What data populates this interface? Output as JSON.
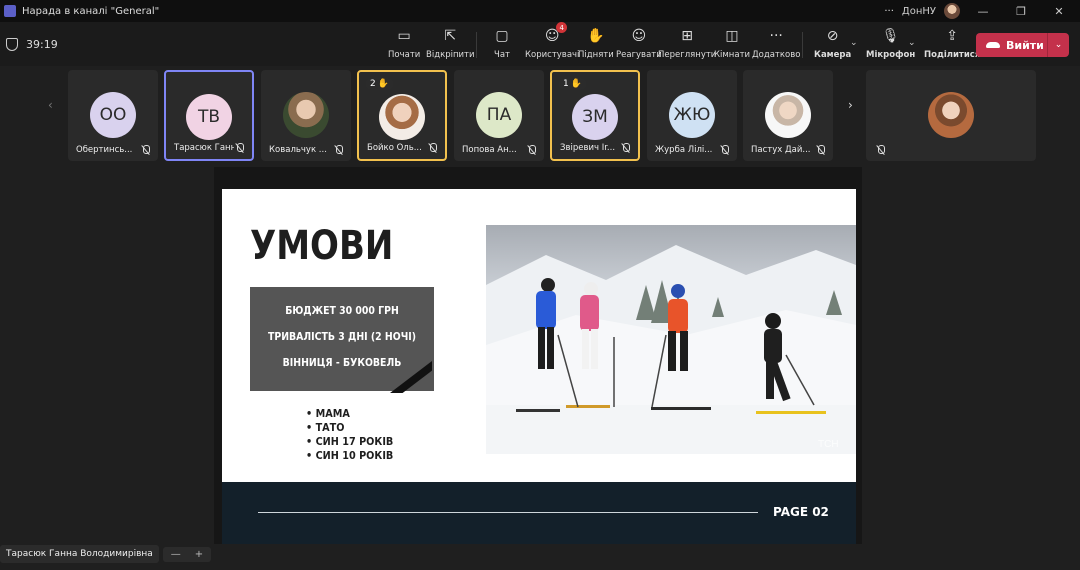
{
  "window": {
    "title": "Нарада в каналі \"General\"",
    "org": "ДонНУ",
    "more": "···",
    "controls": [
      "—",
      "❐",
      "✕"
    ]
  },
  "toolbar": {
    "timer": "39:19",
    "buttons": [
      {
        "label": "Почати",
        "icon": "present-icon"
      },
      {
        "label": "Відкріпити",
        "icon": "unpin-icon"
      },
      {
        "label": "Чат",
        "icon": "chat-icon"
      },
      {
        "label": "Користувачі",
        "icon": "people-icon",
        "badge": "4"
      },
      {
        "label": "Підняти",
        "icon": "raise-hand-icon"
      },
      {
        "label": "Реагувати",
        "icon": "react-icon"
      },
      {
        "label": "Переглянути",
        "icon": "view-icon"
      },
      {
        "label": "Кімнати",
        "icon": "rooms-icon"
      },
      {
        "label": "Додатково",
        "icon": "more-icon"
      },
      {
        "label": "Камера",
        "icon": "camera-off-icon"
      },
      {
        "label": "Мікрофон",
        "icon": "mic-off-icon"
      },
      {
        "label": "Поділитися",
        "icon": "share-icon"
      }
    ],
    "leave_label": "Вийти",
    "colors": {
      "leave": "#c4314b",
      "active_speaker": "#7f85f5",
      "hand_raised": "#f2c14e"
    }
  },
  "participants": [
    {
      "initials": "ОО",
      "name": "Обертинсь...",
      "avatar_color": "#d9d2ee"
    },
    {
      "initials": "ТВ",
      "name": "Тарасюк Ганна ...",
      "avatar_color": "#f1d3e4",
      "active": true
    },
    {
      "initials": "",
      "name": "Ковальчук ...",
      "photo": true
    },
    {
      "initials": "",
      "name": "Бойко Оль...",
      "photo": true,
      "hand": "2"
    },
    {
      "initials": "ПА",
      "name": "Попова Ан...",
      "avatar_color": "#dde8c8"
    },
    {
      "initials": "ЗМ",
      "name": "Звіревич Ir...",
      "avatar_color": "#d9d2ee",
      "hand": "1"
    },
    {
      "initials": "ЖЮ",
      "name": "Журба Лілі...",
      "avatar_color": "#cfe1f3"
    },
    {
      "initials": "",
      "name": "Пастух Дай...",
      "photo": true
    }
  ],
  "slide": {
    "title": "УМОВИ",
    "box_lines": [
      "БЮДЖЕТ 30 000 ГРН",
      "ТРИВАЛІСТЬ 3 ДНІ (2 НОЧІ)",
      "ВІННИЦЯ - БУКОВЕЛЬ"
    ],
    "bullets": [
      "МАМА",
      "ТАТО",
      "СИН 17 РОКІВ",
      "СИН 10 РОКІВ"
    ],
    "page": "PAGE 02",
    "watermark": "TCH"
  },
  "self_view": {
    "name": "Тарасюк Ганна Володимирівна",
    "zoom_out": "—",
    "zoom_in": "+"
  }
}
